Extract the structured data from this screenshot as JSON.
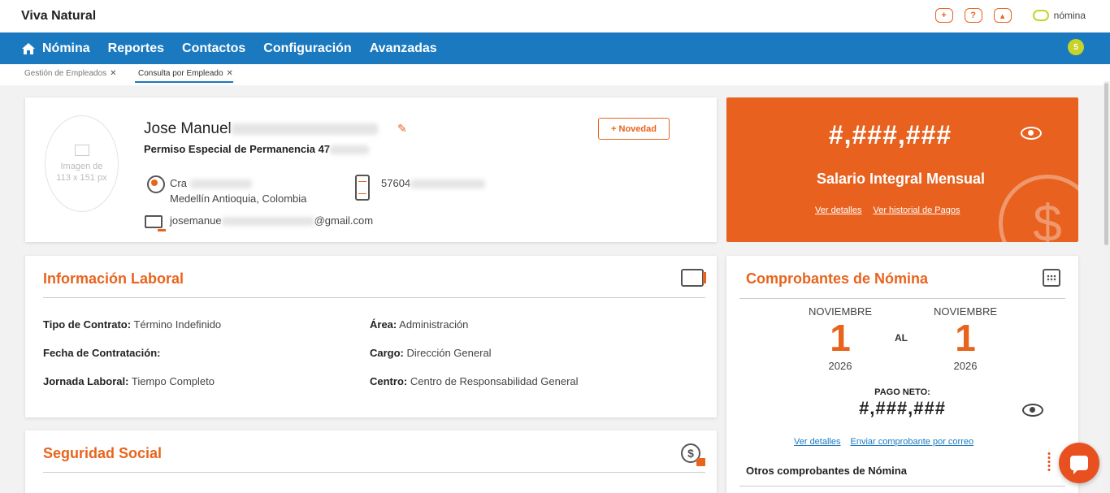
{
  "app": {
    "title": "Viva Natural",
    "logo_text": "nómina",
    "notification_count": "5"
  },
  "top_icons": {
    "add": "+",
    "help": "?",
    "user": "▴"
  },
  "nav": {
    "items": [
      "Nómina",
      "Reportes",
      "Contactos",
      "Configuración",
      "Avanzadas"
    ]
  },
  "tabs": [
    {
      "label": "Gestión de Empleados",
      "close": "✕"
    },
    {
      "label": "Consulta por Empleado",
      "close": "✕"
    }
  ],
  "profile": {
    "avatar_text": "Imagen de 113 x 151 px",
    "name": "Jose Manuel",
    "document": "Permiso Especial de Permanencia 47",
    "address_line1": "Cra",
    "address_line2": "Medellín Antioquia, Colombia",
    "phone": "57604",
    "email_prefix": "josemanue",
    "email_suffix": "@gmail.com",
    "novedad_button": "+ Novedad"
  },
  "salary": {
    "amount": "#,###,###",
    "label": "Salario Integral Mensual",
    "link_details": "Ver detalles",
    "link_history": "Ver historial de Pagos"
  },
  "info_laboral": {
    "title": "Información Laboral",
    "fields": {
      "tipo_contrato_label": "Tipo de Contrato:",
      "tipo_contrato": "Término Indefinido",
      "fecha_label": "Fecha de Contratación:",
      "fecha": "",
      "jornada_label": "Jornada Laboral:",
      "jornada": "Tiempo Completo",
      "area_label": "Área:",
      "area": "Administración",
      "cargo_label": "Cargo:",
      "cargo": "Dirección General",
      "centro_label": "Centro:",
      "centro": "Centro de Responsabilidad General"
    }
  },
  "seguridad_social": {
    "title": "Seguridad Social"
  },
  "comprobantes": {
    "title": "Comprobantes de Nómina",
    "from": {
      "month": "NOVIEMBRE",
      "day": "1",
      "year": "2026"
    },
    "to": {
      "month": "NOVIEMBRE",
      "day": "1",
      "year": "2026"
    },
    "al": "AL",
    "pago_neto_label": "PAGO NETO:",
    "pago_neto": "#,###,###",
    "link_details": "Ver detalles",
    "link_email": "Enviar comprobante por correo",
    "otros": "Otros comprobantes de Nómina"
  },
  "colors": {
    "brand_blue": "#1a79bf",
    "accent_orange": "#e8641d",
    "badge_green": "#c6d42a"
  }
}
